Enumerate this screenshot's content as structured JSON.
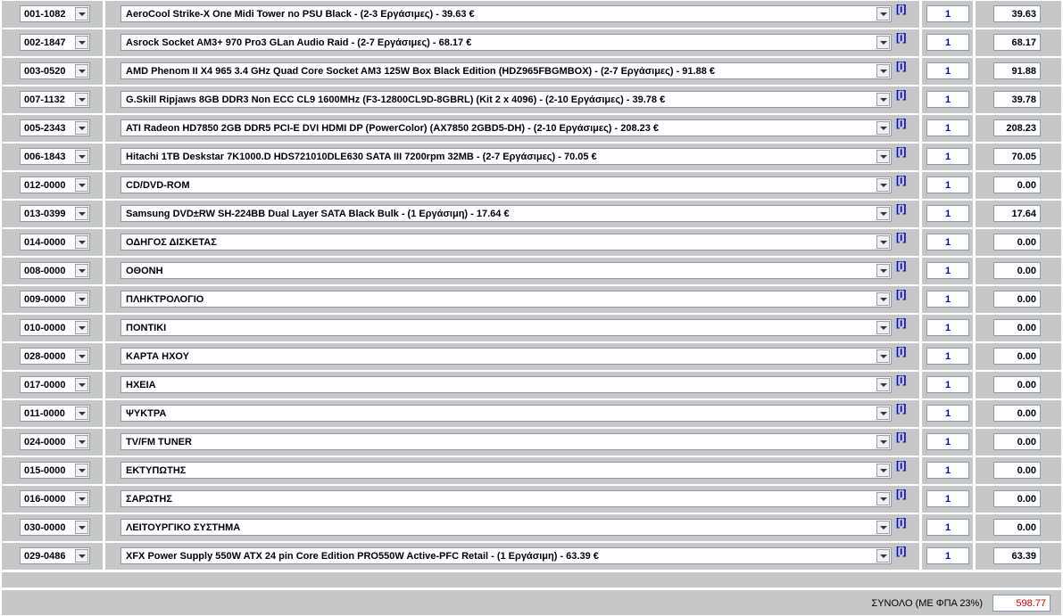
{
  "rows": [
    {
      "code": "001-1082",
      "product": "AeroCool Strike-X One Midi Tower no PSU Black - (2-3 Εργάσιμες) - 39.63 €",
      "qty": "1",
      "price": "39.63"
    },
    {
      "code": "002-1847",
      "product": "Asrock Socket AM3+ 970 Pro3 GLan Audio Raid - (2-7 Εργάσιμες) - 68.17 €",
      "qty": "1",
      "price": "68.17"
    },
    {
      "code": "003-0520",
      "product": "AMD Phenom II X4 965 3.4 GHz Quad Core Socket AM3 125W Box Black Edition (HDZ965FBGMBOX) - (2-7 Εργάσιμες) - 91.88 €",
      "qty": "1",
      "price": "91.88"
    },
    {
      "code": "007-1132",
      "product": "G.Skill Ripjaws 8GB DDR3 Non ECC CL9 1600MHz (F3-12800CL9D-8GBRL) (Kit 2 x 4096) - (2-10 Εργάσιμες) - 39.78 €",
      "qty": "1",
      "price": "39.78"
    },
    {
      "code": "005-2343",
      "product": "ATI Radeon HD7850 2GB DDR5 PCI-E DVI HDMI DP (PowerColor) (AX7850 2GBD5-DH) - (2-10 Εργάσιμες) - 208.23 €",
      "qty": "1",
      "price": "208.23"
    },
    {
      "code": "006-1843",
      "product": "Hitachi 1TB Deskstar 7K1000.D HDS721010DLE630 SATA III 7200rpm 32MB - (2-7 Εργάσιμες) - 70.05 €",
      "qty": "1",
      "price": "70.05"
    },
    {
      "code": "012-0000",
      "product": "CD/DVD-ROM",
      "qty": "1",
      "price": "0.00"
    },
    {
      "code": "013-0399",
      "product": "Samsung DVD±RW SH-224BB Dual Layer SATA Black Bulk - (1 Εργάσιμη) - 17.64 €",
      "qty": "1",
      "price": "17.64"
    },
    {
      "code": "014-0000",
      "product": "ΟΔΗΓΟΣ ΔΙΣΚΕΤΑΣ",
      "qty": "1",
      "price": "0.00"
    },
    {
      "code": "008-0000",
      "product": "ΟΘΟΝΗ",
      "qty": "1",
      "price": "0.00"
    },
    {
      "code": "009-0000",
      "product": "ΠΛΗΚΤΡΟΛΟΓΙΟ",
      "qty": "1",
      "price": "0.00"
    },
    {
      "code": "010-0000",
      "product": "ΠΟΝΤΙΚΙ",
      "qty": "1",
      "price": "0.00"
    },
    {
      "code": "028-0000",
      "product": "ΚΑΡΤΑ ΗΧΟΥ",
      "qty": "1",
      "price": "0.00"
    },
    {
      "code": "017-0000",
      "product": "ΗΧΕΙΑ",
      "qty": "1",
      "price": "0.00"
    },
    {
      "code": "011-0000",
      "product": "ΨΥΚΤΡΑ",
      "qty": "1",
      "price": "0.00"
    },
    {
      "code": "024-0000",
      "product": "TV/FM TUNER",
      "qty": "1",
      "price": "0.00"
    },
    {
      "code": "015-0000",
      "product": "ΕΚΤΥΠΩΤΗΣ",
      "qty": "1",
      "price": "0.00"
    },
    {
      "code": "016-0000",
      "product": "ΣΑΡΩΤΗΣ",
      "qty": "1",
      "price": "0.00"
    },
    {
      "code": "030-0000",
      "product": "ΛΕΙΤΟΥΡΓΙΚΟ ΣΥΣΤΗΜΑ",
      "qty": "1",
      "price": "0.00"
    },
    {
      "code": "029-0486",
      "product": "XFX Power Supply 550W ATX 24 pin Core Edition PRO550W Active-PFC Retail - (1 Εργάσιμη) - 63.39 €",
      "qty": "1",
      "price": "63.39"
    }
  ],
  "info_label": "[i]",
  "total": {
    "label": "ΣΥΝΟΛΟ (ΜΕ ΦΠΑ 23%)",
    "value": "598.77"
  },
  "colors": {
    "panel": "#c7c7c7",
    "input_border": "#7f9db9",
    "qty_text": "#0000cc",
    "info_link": "#0000cc",
    "total_value": "#cc0000"
  }
}
